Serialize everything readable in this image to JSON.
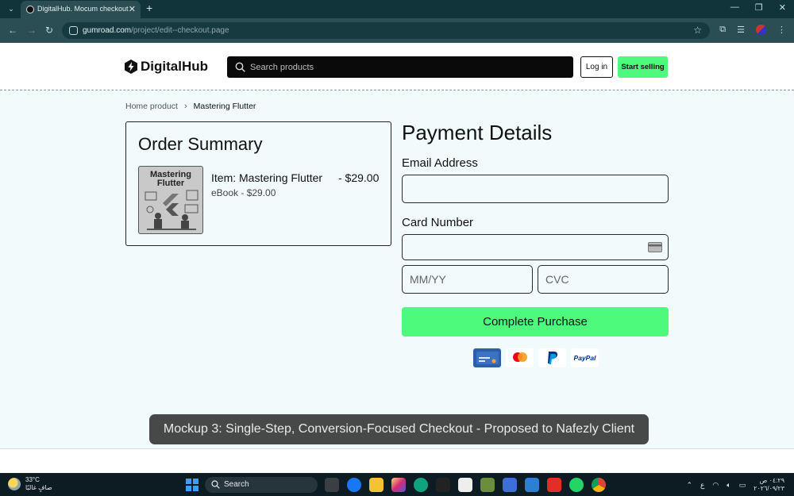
{
  "browser": {
    "tab_title": "DigitalHub. Mocum checkout",
    "url_host": "gumroad.com",
    "url_path": "/project/edit--checkout.page",
    "close_glyph": "✕",
    "new_tab_glyph": "+",
    "tab_list_glyph": "⌄"
  },
  "header": {
    "brand": "DigitalHub",
    "search_placeholder": "Search products",
    "login_label": "Log in",
    "start_selling_label": "Start selling"
  },
  "breadcrumb": {
    "home": "Home product",
    "separator": "›",
    "current": "Mastering Flutter"
  },
  "order_summary": {
    "title": "Order Summary",
    "thumbnail_title": "Mastering Flutter",
    "item_name": "Item: Mastering Flutter",
    "item_price": "- $29.00",
    "item_sub": "eBook - $29.00"
  },
  "payment": {
    "title": "Payment Details",
    "email_label": "Email Address",
    "email_value": "",
    "card_label": "Card Number",
    "card_value": "",
    "expiry_placeholder": "MM/YY",
    "cvc_placeholder": "CVC",
    "submit_label": "Complete Purchase",
    "methods": [
      "card-icon",
      "mastercard-icon",
      "paypal-icon",
      "paypal-wordmark"
    ],
    "paypal_text": "PayPal"
  },
  "caption": "Mockup 3: Single-Step, Conversion-Focused Checkout - Proposed to Nafezly Client",
  "taskbar": {
    "temperature": "33°C",
    "weather_desc": "صافٍ غالبًا",
    "search_label": "Search",
    "time": "٠٤:٢٩ ص",
    "date": "٢٠٢٦/٠٩/٢٣",
    "lang": "ع"
  },
  "colors": {
    "accent_green": "#4dfa7c",
    "page_bg": "#f1fbfb",
    "chrome_dark": "#10343a"
  }
}
